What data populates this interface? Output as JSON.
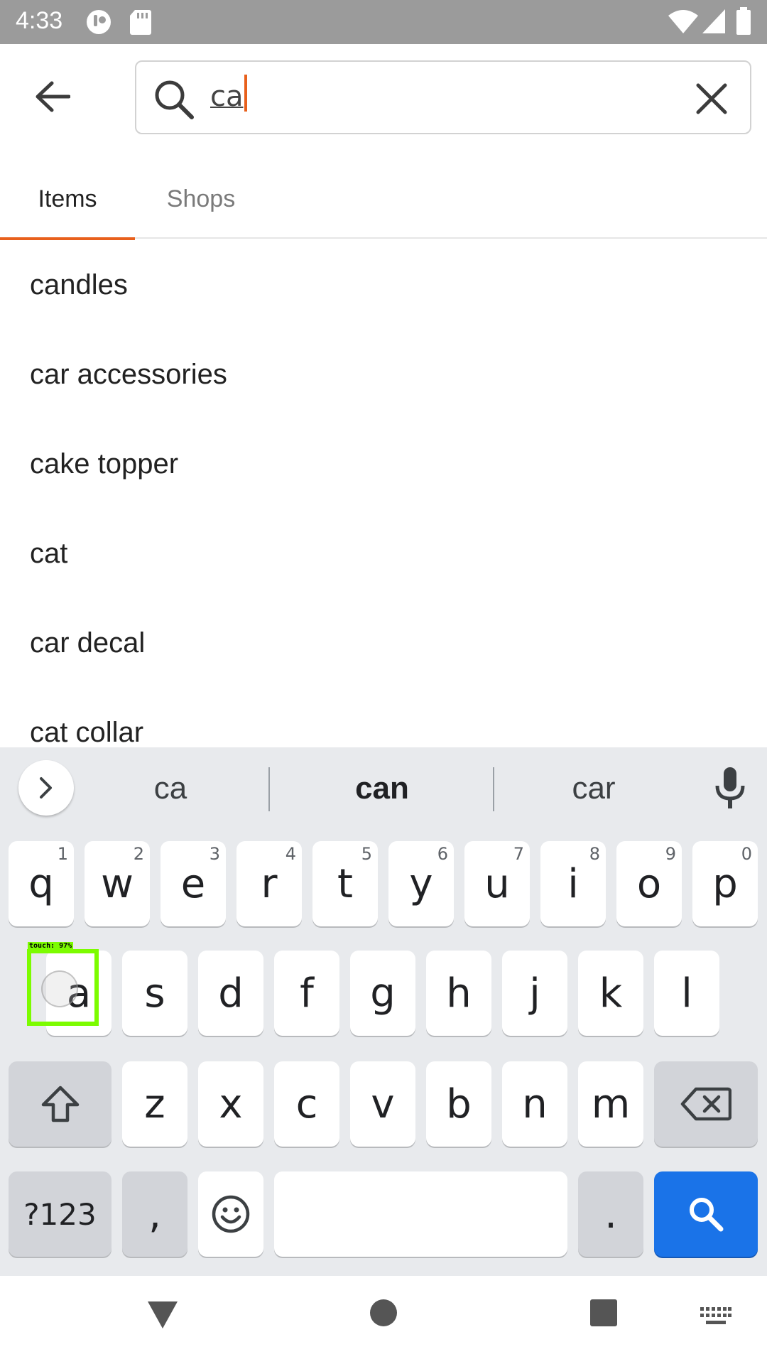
{
  "status_bar": {
    "time": "4:33"
  },
  "search": {
    "query": "ca"
  },
  "tabs": [
    {
      "label": "Items",
      "selected": true
    },
    {
      "label": "Shops",
      "selected": false
    }
  ],
  "suggestions": [
    "candles",
    "car accessories",
    "cake topper",
    "cat",
    "car decal",
    "cat collar"
  ],
  "keyboard": {
    "suggestions": [
      "ca",
      "can",
      "car"
    ],
    "row1": [
      {
        "key": "q",
        "hint": "1"
      },
      {
        "key": "w",
        "hint": "2"
      },
      {
        "key": "e",
        "hint": "3"
      },
      {
        "key": "r",
        "hint": "4"
      },
      {
        "key": "t",
        "hint": "5"
      },
      {
        "key": "y",
        "hint": "6"
      },
      {
        "key": "u",
        "hint": "7"
      },
      {
        "key": "i",
        "hint": "8"
      },
      {
        "key": "o",
        "hint": "9"
      },
      {
        "key": "p",
        "hint": "0"
      }
    ],
    "row2": [
      "a",
      "s",
      "d",
      "f",
      "g",
      "h",
      "j",
      "k",
      "l"
    ],
    "row3": [
      "z",
      "x",
      "c",
      "v",
      "b",
      "n",
      "m"
    ],
    "symbols_key": "?123",
    "comma_key": ",",
    "period_key": "."
  },
  "touch_overlay": {
    "label": "touch: 97%"
  },
  "colors": {
    "accent": "#e8601c",
    "keyboard_action": "#1a73e8",
    "touch_highlight": "#7cfc00"
  }
}
